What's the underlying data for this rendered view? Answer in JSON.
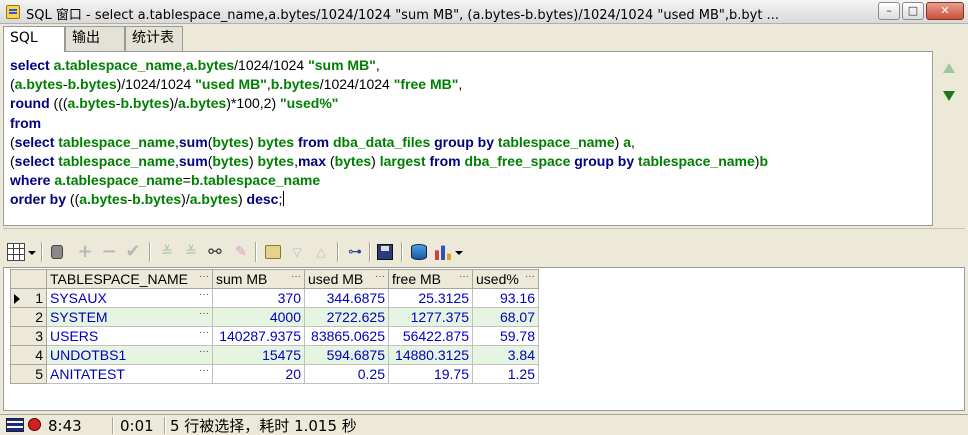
{
  "window": {
    "title": "SQL 窗口 - select a.tablespace_name,a.bytes/1024/1024 \"sum MB\", (a.bytes-b.bytes)/1024/1024 \"used MB\",b.byt ...",
    "minimize_icon": "minimize-icon",
    "maximize_icon": "maximize-icon",
    "close_icon": "close-icon"
  },
  "tabs": [
    {
      "label": "SQL",
      "active": true
    },
    {
      "label": "输出",
      "active": false
    },
    {
      "label": "统计表",
      "active": false
    }
  ],
  "editor": {
    "lines": [
      [
        [
          "kw",
          "select "
        ],
        [
          "id",
          "a.tablespace_name"
        ],
        [
          "op",
          ","
        ],
        [
          "id",
          "a.bytes"
        ],
        [
          "op",
          "/1024/1024 "
        ],
        [
          "str",
          "\"sum MB\""
        ],
        [
          "op",
          ","
        ]
      ],
      [
        [
          "op",
          "("
        ],
        [
          "id",
          "a.bytes"
        ],
        [
          "op",
          "-"
        ],
        [
          "id",
          "b.bytes"
        ],
        [
          "op",
          ")/1024/1024 "
        ],
        [
          "str",
          "\"used MB\""
        ],
        [
          "op",
          ","
        ],
        [
          "id",
          "b.bytes"
        ],
        [
          "op",
          "/1024/1024 "
        ],
        [
          "str",
          "\"free MB\""
        ],
        [
          "op",
          ","
        ]
      ],
      [
        [
          "kw",
          "round "
        ],
        [
          "op",
          "((("
        ],
        [
          "id",
          "a.bytes"
        ],
        [
          "op",
          "-"
        ],
        [
          "id",
          "b.bytes"
        ],
        [
          "op",
          ")/"
        ],
        [
          "id",
          "a.bytes"
        ],
        [
          "op",
          ")*100,2) "
        ],
        [
          "str",
          "\"used%\""
        ]
      ],
      [
        [
          "kw",
          "from"
        ]
      ],
      [
        [
          "op",
          "("
        ],
        [
          "kw",
          "select "
        ],
        [
          "id",
          "tablespace_name"
        ],
        [
          "op",
          ","
        ],
        [
          "kw",
          "sum"
        ],
        [
          "op",
          "("
        ],
        [
          "id",
          "bytes"
        ],
        [
          "op",
          ") "
        ],
        [
          "id",
          "bytes "
        ],
        [
          "kw",
          "from "
        ],
        [
          "id",
          "dba_data_files "
        ],
        [
          "kw",
          "group by "
        ],
        [
          "id",
          "tablespace_name"
        ],
        [
          "op",
          ") "
        ],
        [
          "id",
          "a"
        ],
        [
          "op",
          ","
        ]
      ],
      [
        [
          "op",
          "("
        ],
        [
          "kw",
          "select "
        ],
        [
          "id",
          "tablespace_name"
        ],
        [
          "op",
          ","
        ],
        [
          "kw",
          "sum"
        ],
        [
          "op",
          "("
        ],
        [
          "id",
          "bytes"
        ],
        [
          "op",
          ") "
        ],
        [
          "id",
          "bytes"
        ],
        [
          "op",
          ","
        ],
        [
          "kw",
          "max "
        ],
        [
          "op",
          "("
        ],
        [
          "id",
          "bytes"
        ],
        [
          "op",
          ") "
        ],
        [
          "id",
          "largest "
        ],
        [
          "kw",
          "from "
        ],
        [
          "id",
          "dba_free_space "
        ],
        [
          "kw",
          "group by "
        ],
        [
          "id",
          "tablespace_name"
        ],
        [
          "op",
          ")"
        ],
        [
          "id",
          "b"
        ]
      ],
      [
        [
          "kw",
          "where "
        ],
        [
          "id",
          "a.tablespace_name"
        ],
        [
          "op",
          "="
        ],
        [
          "id",
          "b.tablespace_name"
        ]
      ],
      [
        [
          "kw",
          "order by "
        ],
        [
          "op",
          "(("
        ],
        [
          "id",
          "a.bytes"
        ],
        [
          "op",
          "-"
        ],
        [
          "id",
          "b.bytes"
        ],
        [
          "op",
          ")/"
        ],
        [
          "id",
          "a.bytes"
        ],
        [
          "op",
          ") "
        ],
        [
          "kw",
          "desc"
        ],
        [
          "op",
          ";"
        ]
      ]
    ],
    "scroll_up_icon": "arrow-up-icon",
    "scroll_down_icon": "arrow-down-icon"
  },
  "toolbar": {
    "icons": [
      "grid-icon",
      "lock-icon",
      "plus-icon",
      "minus-icon",
      "check-icon",
      "next-record-icon",
      "last-record-icon",
      "find-icon",
      "clear-icon",
      "query-icon",
      "arrow-down-icon",
      "arrow-up-icon",
      "tree-icon",
      "save-icon",
      "database-icon",
      "chart-icon"
    ]
  },
  "results": {
    "columns": [
      "TABLESPACE_NAME",
      "sum MB",
      "used MB",
      "free MB",
      "used%"
    ],
    "rows": [
      {
        "num": "1",
        "name": "SYSAUX",
        "sum": "370",
        "used": "344.6875",
        "free": "25.3125",
        "pct": "93.16",
        "current": true
      },
      {
        "num": "2",
        "name": "SYSTEM",
        "sum": "4000",
        "used": "2722.625",
        "free": "1277.375",
        "pct": "68.07",
        "current": false
      },
      {
        "num": "3",
        "name": "USERS",
        "sum": "140287.9375",
        "used": "83865.0625",
        "free": "56422.875",
        "pct": "59.78",
        "current": false
      },
      {
        "num": "4",
        "name": "UNDOTBS1",
        "sum": "15475",
        "used": "594.6875",
        "free": "14880.3125",
        "pct": "3.84",
        "current": false
      },
      {
        "num": "5",
        "name": "ANITATEST",
        "sum": "20",
        "used": "0.25",
        "free": "19.75",
        "pct": "1.25",
        "current": false
      }
    ],
    "ellipsis": "···"
  },
  "status": {
    "cursor": "8:43",
    "elapsed": "0:01",
    "message": "5 行被选择，耗时 1.015 秒"
  }
}
